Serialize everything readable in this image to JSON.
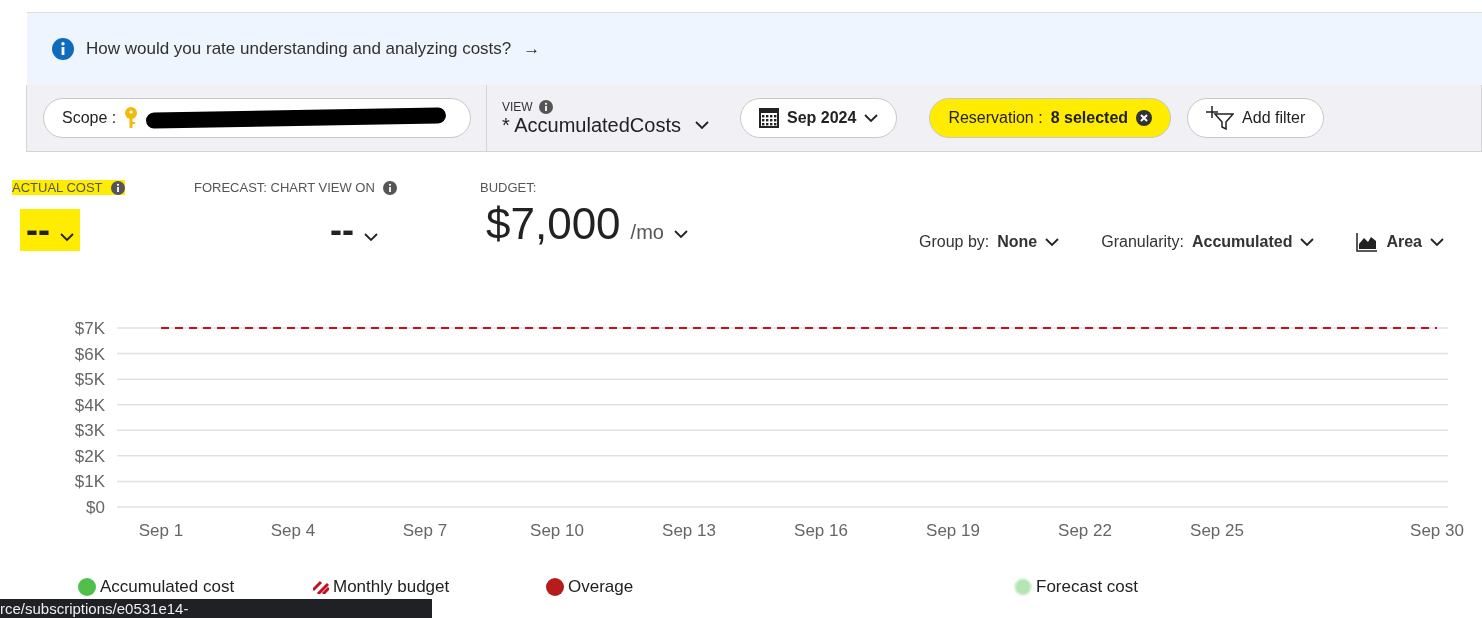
{
  "banner": {
    "text": "How would you rate understanding and analyzing costs?",
    "arrow": "→"
  },
  "toolbar": {
    "scope": {
      "label": "Scope",
      "separator": ":",
      "redacted": true
    },
    "view": {
      "label": "VIEW",
      "value": "* AccumulatedCosts"
    },
    "date": {
      "value": "Sep 2024"
    },
    "filters": [
      {
        "kind": "filter",
        "label": "Reservation",
        "separator": ":",
        "value": "8 selected",
        "highlighted": true
      },
      {
        "kind": "add",
        "label": "Add filter",
        "highlighted": false
      }
    ]
  },
  "metrics": [
    {
      "label": "ACTUAL COST",
      "info": true,
      "value": "--",
      "highlighted": true
    },
    {
      "label": "FORECAST: CHART VIEW ON",
      "info": true,
      "value": "--",
      "highlighted": false
    },
    {
      "label": "BUDGET:",
      "info": false,
      "value": "$7,000",
      "unit": "/mo",
      "highlighted": false
    }
  ],
  "controls": [
    {
      "kind": "text",
      "label": "Group by:",
      "value": "None"
    },
    {
      "kind": "text",
      "label": "Granularity:",
      "value": "Accumulated"
    },
    {
      "kind": "chart",
      "value": "Area"
    }
  ],
  "chart": {
    "chart_data": {
      "type": "line",
      "ylim": [
        0,
        7000
      ],
      "grid": true,
      "categories": [
        "Sep 1",
        null,
        null,
        "Sep 4",
        null,
        null,
        "Sep 7",
        null,
        null,
        "Sep 10",
        null,
        null,
        "Sep 13",
        null,
        null,
        "Sep 16",
        null,
        null,
        "Sep 19",
        null,
        null,
        "Sep 22",
        null,
        null,
        "Sep 25",
        null,
        null,
        null,
        null,
        "Sep 30"
      ],
      "yticks": [
        {
          "value": 0,
          "label": "$0"
        },
        {
          "value": 1000,
          "label": "$1K"
        },
        {
          "value": 2000,
          "label": "$2K"
        },
        {
          "value": 3000,
          "label": "$3K"
        },
        {
          "value": 4000,
          "label": "$4K"
        },
        {
          "value": 5000,
          "label": "$5K"
        },
        {
          "value": 6000,
          "label": "$6K"
        },
        {
          "value": 7000,
          "label": "$7K"
        }
      ],
      "series": [
        {
          "color": "#c50f1f",
          "line_style": "dashed",
          "values": [
            7000,
            7000,
            7000,
            7000,
            7000,
            7000,
            7000,
            7000,
            7000,
            7000,
            7000,
            7000,
            7000,
            7000,
            7000,
            7000,
            7000,
            7000,
            7000,
            7000,
            7000,
            7000,
            7000,
            7000,
            7000,
            7000,
            7000,
            7000,
            7000,
            7000
          ]
        }
      ]
    }
  },
  "legend": [
    {
      "kind": "dot",
      "label": "Accumulated cost",
      "color": "#4fc04a"
    },
    {
      "kind": "stripes",
      "label": "Monthly budget",
      "color": "#c50f1f"
    },
    {
      "kind": "dot",
      "label": "Overage",
      "color": "#b71c1c"
    },
    {
      "kind": "ring",
      "label": "Forecast cost",
      "color": "#b5e6b2"
    }
  ],
  "status_bar": {
    "text": "rce/subscriptions/e0531e14-"
  }
}
